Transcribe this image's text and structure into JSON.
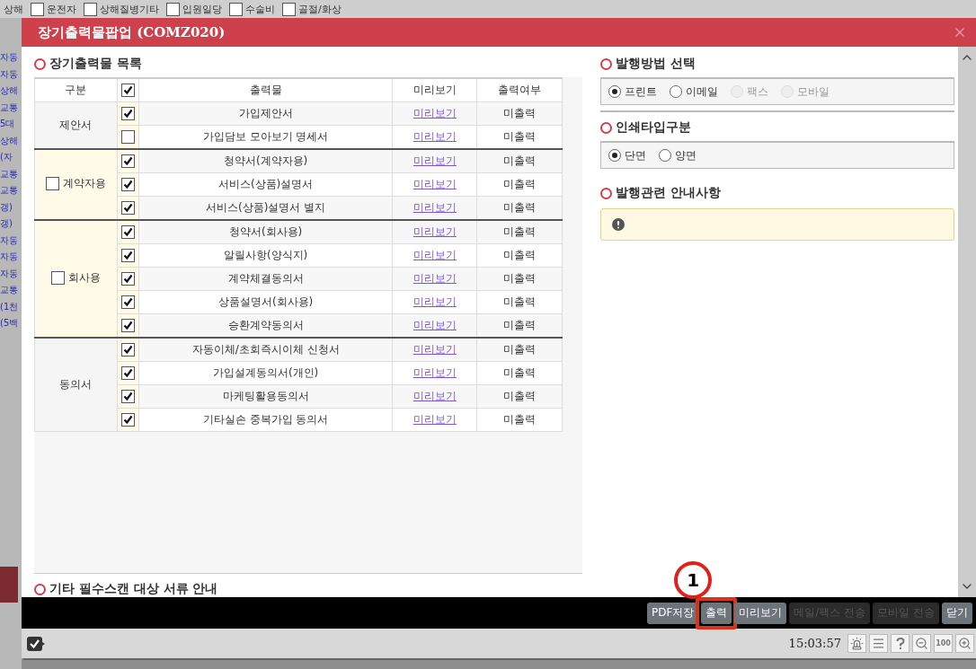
{
  "background": {
    "top_labels": [
      {
        "label": "상해",
        "kind": "text"
      },
      {
        "label": "운전자",
        "kind": "check",
        "checked": false
      },
      {
        "label": "상해질병기타",
        "kind": "check",
        "checked": false
      },
      {
        "label": "입원일당",
        "kind": "check",
        "checked": false
      },
      {
        "label": "수술비",
        "kind": "check",
        "checked": false
      },
      {
        "label": "골절/화상",
        "kind": "check",
        "checked": false
      }
    ],
    "side_labels": [
      "자동",
      "자동",
      "상해",
      "교통",
      "5대",
      "상해",
      "(자",
      "교통",
      "교통",
      "갱)",
      "갱)",
      "자동",
      "자동",
      "자동",
      "교통",
      "(1천",
      "(5백"
    ]
  },
  "window": {
    "title": "장기출력물팝업 (COMZ020)"
  },
  "list_section": {
    "title": "장기출력물 목록",
    "columns": [
      "구분",
      "출력물",
      "미리보기",
      "출력여부"
    ],
    "all_checked": true,
    "groups": [
      {
        "label": "제안서",
        "kind": "plain",
        "rows": [
          {
            "checked": true,
            "name": "가입제안서",
            "preview": "미리보기",
            "status": "미출력"
          },
          {
            "checked": false,
            "name": "가입담보 모아보기 명세서",
            "preview": "미리보기",
            "status": "미출력"
          }
        ]
      },
      {
        "label": "계약자용",
        "kind": "check",
        "checked": false,
        "rows": [
          {
            "checked": true,
            "name": "청약서(계약자용)",
            "preview": "미리보기",
            "status": "미출력"
          },
          {
            "checked": true,
            "name": "서비스(상품)설명서",
            "preview": "미리보기",
            "status": "미출력"
          },
          {
            "checked": true,
            "name": "서비스(상품)설명서 별지",
            "preview": "미리보기",
            "status": "미출력"
          }
        ]
      },
      {
        "label": "회사용",
        "kind": "check",
        "checked": false,
        "rows": [
          {
            "checked": true,
            "name": "청약서(회사용)",
            "preview": "미리보기",
            "status": "미출력"
          },
          {
            "checked": true,
            "name": "알릴사항(양식지)",
            "preview": "미리보기",
            "status": "미출력"
          },
          {
            "checked": true,
            "name": "계약체결동의서",
            "preview": "미리보기",
            "status": "미출력"
          },
          {
            "checked": true,
            "name": "상품설명서(회사용)",
            "preview": "미리보기",
            "status": "미출력"
          },
          {
            "checked": true,
            "name": "승환계약동의서",
            "preview": "미리보기",
            "status": "미출력"
          }
        ]
      },
      {
        "label": "동의서",
        "kind": "plain",
        "rows": [
          {
            "checked": true,
            "name": "자동이체/초회즉시이체 신청서",
            "preview": "미리보기",
            "status": "미출력"
          },
          {
            "checked": true,
            "name": "가입설계동의서(개인)",
            "preview": "미리보기",
            "status": "미출력"
          },
          {
            "checked": true,
            "name": "마케팅활용동의서",
            "preview": "미리보기",
            "status": "미출력"
          },
          {
            "checked": true,
            "name": "기타실손 중복가입 동의서",
            "preview": "미리보기",
            "status": "미출력"
          }
        ]
      }
    ],
    "next_title": "기타 필수스캔 대상 서류 안내"
  },
  "method_section": {
    "title": "발행방법 선택",
    "options": [
      {
        "label": "프린트",
        "selected": true,
        "disabled": false
      },
      {
        "label": "이메일",
        "selected": false,
        "disabled": false
      },
      {
        "label": "팩스",
        "selected": false,
        "disabled": true
      },
      {
        "label": "모바일",
        "selected": false,
        "disabled": true
      }
    ]
  },
  "print_type_section": {
    "title": "인쇄타입구분",
    "options": [
      {
        "label": "단면",
        "selected": true,
        "disabled": false
      },
      {
        "label": "양면",
        "selected": false,
        "disabled": false
      }
    ]
  },
  "notice_section": {
    "title": "발행관련 안내사항"
  },
  "actions": [
    {
      "label": "PDF저장",
      "disabled": false,
      "highlighted": false
    },
    {
      "label": "출력",
      "disabled": false,
      "highlighted": true,
      "marker": "1"
    },
    {
      "label": "미리보기",
      "disabled": false,
      "highlighted": false
    },
    {
      "label": "메일/팩스 전송",
      "disabled": true,
      "highlighted": false
    },
    {
      "label": "모바일 전송",
      "disabled": true,
      "highlighted": false
    },
    {
      "label": "닫기",
      "disabled": false,
      "highlighted": false
    }
  ],
  "status_bar": {
    "time": "15:03:57",
    "zoom_label": "100"
  }
}
